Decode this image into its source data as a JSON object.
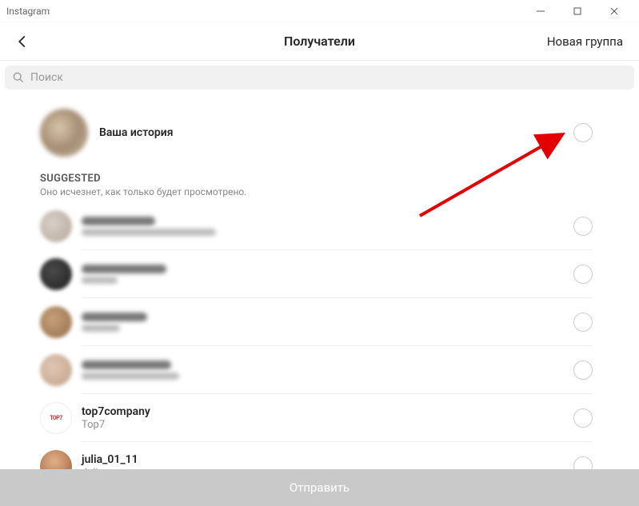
{
  "window": {
    "title": "Instagram"
  },
  "header": {
    "title": "Получатели",
    "new_group": "Новая группа"
  },
  "search": {
    "placeholder": "Поиск"
  },
  "story": {
    "label": "Ваша история"
  },
  "suggested": {
    "title": "SUGGESTED",
    "subtitle": "Оно исчезнет, как только будет просмотрено."
  },
  "items": [
    {
      "blurred": true,
      "name_w": 92,
      "sub_w": 168
    },
    {
      "blurred": true,
      "name_w": 106,
      "sub_w": 45
    },
    {
      "blurred": true,
      "name_w": 82,
      "sub_w": 48
    },
    {
      "blurred": true,
      "name_w": 112,
      "sub_w": 122
    },
    {
      "blurred": false,
      "name": "top7company",
      "sub": "Top7",
      "avatar_type": "top7"
    },
    {
      "blurred": false,
      "name": "julia_01_11",
      "sub": "Julia",
      "avatar_type": "julia"
    }
  ],
  "send": {
    "label": "Отправить"
  }
}
